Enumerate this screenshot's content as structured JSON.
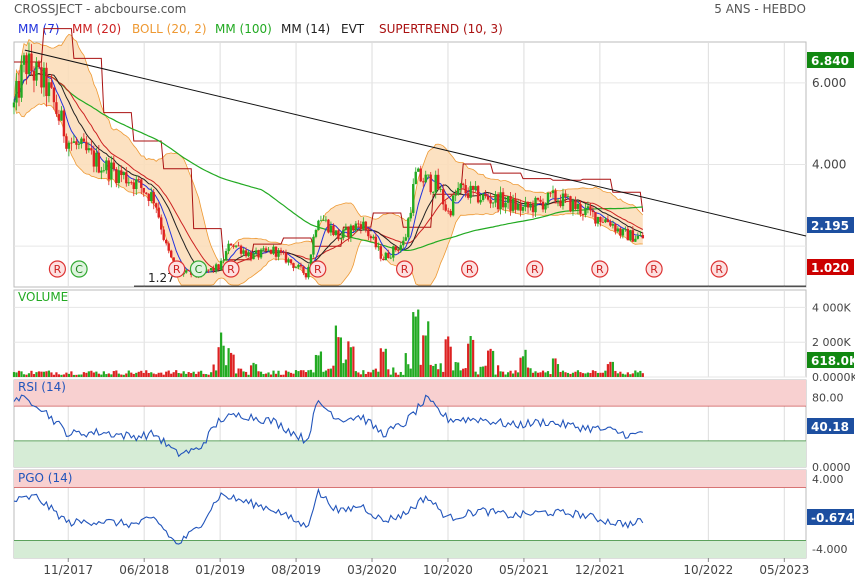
{
  "header": {
    "title": "CROSSJECT - abcbourse.com",
    "period": "5 ANS - HEBDO"
  },
  "legend": [
    {
      "label": "MM (7)",
      "color": "#2233dd"
    },
    {
      "label": "MM (20)",
      "color": "#cc2222"
    },
    {
      "label": "BOLL (20, 2)",
      "color": "#ee9933"
    },
    {
      "label": "MM (100)",
      "color": "#22aa22"
    },
    {
      "label": "MM (14)",
      "color": "#222222"
    },
    {
      "label": "EVT",
      "color": "#222222"
    },
    {
      "label": "SUPERTREND (10, 3)",
      "color": "#aa1111"
    }
  ],
  "colors": {
    "up": "#22aa22",
    "down": "#dd2222",
    "rsi": "#2255bb",
    "overbought_fill": "#f8d0d0",
    "oversold_fill": "#d6ecd6",
    "last_price_badge": "#118811",
    "axis_badge": "#1d4fa0",
    "support_badge": "#cc0000",
    "boll_fill": "#fbdcb6"
  },
  "x_axis": {
    "ticks": [
      "11/2017",
      "06/2018",
      "01/2019",
      "08/2019",
      "03/2020",
      "10/2020",
      "05/2021",
      "12/2021",
      "10/2022",
      "05/2023"
    ]
  },
  "chart_data": [
    {
      "type": "candlestick",
      "panel": "price",
      "y_ticks": [
        "6.000",
        "4.000"
      ],
      "y_tick_values": [
        6.0,
        4.0,
        2.0
      ],
      "y_range": [
        1.0,
        7.0
      ],
      "last_price": "6.840",
      "level_label": "2.195",
      "support_label": "1.020",
      "support_value": 1.02,
      "min_annotation": "1.27",
      "min_annotation_value": 1.27,
      "trendline": [
        {
          "x": "2017-07",
          "y": 6.8
        },
        {
          "x": "2023-04",
          "y": 2.25
        }
      ],
      "price_points": [
        [
          "2017-06",
          5.4
        ],
        [
          "2017-07",
          6.5
        ],
        [
          "2017-09",
          5.9
        ],
        [
          "2017-11",
          4.6
        ],
        [
          "2018-02",
          4.0
        ],
        [
          "2018-05",
          3.6
        ],
        [
          "2018-07",
          3.15
        ],
        [
          "2018-08",
          2.0
        ],
        [
          "2018-09",
          1.35
        ],
        [
          "2018-11",
          1.3
        ],
        [
          "2019-01",
          1.5
        ],
        [
          "2019-02",
          2.1
        ],
        [
          "2019-04",
          1.75
        ],
        [
          "2019-06",
          1.9
        ],
        [
          "2019-09",
          1.3
        ],
        [
          "2019-10",
          2.8
        ],
        [
          "2019-12",
          2.2
        ],
        [
          "2020-02",
          2.6
        ],
        [
          "2020-04",
          1.7
        ],
        [
          "2020-06",
          2.1
        ],
        [
          "2020-07",
          3.7
        ],
        [
          "2020-09",
          3.5
        ],
        [
          "2020-10",
          2.8
        ],
        [
          "2020-11",
          3.4
        ],
        [
          "2021-01",
          3.2
        ],
        [
          "2021-03",
          3.1
        ],
        [
          "2021-05",
          2.9
        ],
        [
          "2021-08",
          3.2
        ],
        [
          "2021-11",
          2.8
        ],
        [
          "2022-01",
          2.6
        ],
        [
          "2022-02",
          2.3
        ],
        [
          "2022-04",
          2.2
        ]
      ],
      "signals": [
        {
          "x": "2017-10",
          "label": "R"
        },
        {
          "x": "2017-12",
          "label": "C"
        },
        {
          "x": "2018-09",
          "label": "R"
        },
        {
          "x": "2018-11",
          "label": "C"
        },
        {
          "x": "2019-02",
          "label": "R"
        },
        {
          "x": "2019-10",
          "label": "R"
        },
        {
          "x": "2020-06",
          "label": "R"
        },
        {
          "x": "2020-12",
          "label": "R"
        },
        {
          "x": "2021-06",
          "label": "R"
        },
        {
          "x": "2021-12",
          "label": "R"
        },
        {
          "x": "2022-05",
          "label": "R"
        },
        {
          "x": "2022-11",
          "label": "R"
        }
      ]
    },
    {
      "type": "bar",
      "panel": "volume",
      "title": "VOLUME",
      "y_ticks": [
        "4 000K",
        "2 000K",
        "0.0000K"
      ],
      "y_tick_values": [
        4000,
        2000,
        0
      ],
      "y_range": [
        0,
        5000
      ],
      "last_value": "618.0K",
      "spikes": [
        [
          "2019-01",
          2600
        ],
        [
          "2019-02",
          1800
        ],
        [
          "2019-04",
          1000
        ],
        [
          "2019-10",
          1500
        ],
        [
          "2019-12",
          3000
        ],
        [
          "2020-01",
          2100
        ],
        [
          "2020-04",
          1900
        ],
        [
          "2020-07",
          4300
        ],
        [
          "2020-08",
          3500
        ],
        [
          "2020-10",
          2900
        ],
        [
          "2020-12",
          2500
        ],
        [
          "2021-02",
          2000
        ],
        [
          "2021-05",
          1600
        ],
        [
          "2021-08",
          1200
        ],
        [
          "2022-01",
          900
        ]
      ]
    },
    {
      "type": "line",
      "panel": "rsi",
      "title": "RSI (14)",
      "y_ticks": [
        "80.00",
        "0.0000"
      ],
      "y_tick_values": [
        80,
        0
      ],
      "y_range": [
        0,
        100
      ],
      "overbought": 70,
      "oversold": 30,
      "last_value": "40.18",
      "points": [
        [
          "2017-06",
          80
        ],
        [
          "2017-08",
          74
        ],
        [
          "2017-11",
          38
        ],
        [
          "2018-02",
          40
        ],
        [
          "2018-05",
          35
        ],
        [
          "2018-07",
          38
        ],
        [
          "2018-09",
          15
        ],
        [
          "2018-11",
          20
        ],
        [
          "2019-01",
          55
        ],
        [
          "2019-03",
          60
        ],
        [
          "2019-06",
          52
        ],
        [
          "2019-09",
          30
        ],
        [
          "2019-10",
          75
        ],
        [
          "2019-12",
          55
        ],
        [
          "2020-02",
          58
        ],
        [
          "2020-04",
          38
        ],
        [
          "2020-06",
          50
        ],
        [
          "2020-08",
          78
        ],
        [
          "2020-10",
          55
        ],
        [
          "2021-01",
          55
        ],
        [
          "2021-04",
          48
        ],
        [
          "2021-07",
          52
        ],
        [
          "2021-10",
          46
        ],
        [
          "2022-01",
          42
        ],
        [
          "2022-03",
          36
        ],
        [
          "2022-04",
          40
        ]
      ]
    },
    {
      "type": "line",
      "panel": "pgo",
      "title": "PGO (14)",
      "y_ticks": [
        "4.000",
        "-4.000"
      ],
      "y_tick_values": [
        4,
        -4
      ],
      "y_range": [
        -5,
        5
      ],
      "upper": 3.0,
      "lower": -3.0,
      "last_value": "-0.6746",
      "points": [
        [
          "2017-06",
          1.5
        ],
        [
          "2017-08",
          2.0
        ],
        [
          "2017-11",
          -1.0
        ],
        [
          "2018-02",
          -0.8
        ],
        [
          "2018-05",
          -1.2
        ],
        [
          "2018-07",
          -0.5
        ],
        [
          "2018-09",
          -3.5
        ],
        [
          "2018-11",
          -1.5
        ],
        [
          "2019-01",
          2.2
        ],
        [
          "2019-03",
          1.5
        ],
        [
          "2019-06",
          0.5
        ],
        [
          "2019-09",
          -1.5
        ],
        [
          "2019-10",
          2.5
        ],
        [
          "2019-12",
          0.2
        ],
        [
          "2020-02",
          1.0
        ],
        [
          "2020-04",
          -0.8
        ],
        [
          "2020-06",
          0.0
        ],
        [
          "2020-08",
          2.0
        ],
        [
          "2020-10",
          -0.5
        ],
        [
          "2021-01",
          0.4
        ],
        [
          "2021-04",
          -0.2
        ],
        [
          "2021-07",
          0.2
        ],
        [
          "2021-10",
          0.0
        ],
        [
          "2022-01",
          -0.9
        ],
        [
          "2022-03",
          -1.2
        ],
        [
          "2022-04",
          -0.67
        ]
      ]
    }
  ]
}
